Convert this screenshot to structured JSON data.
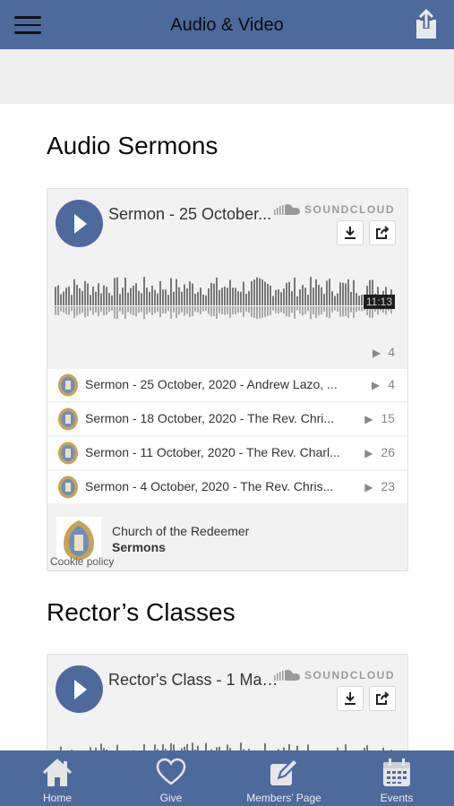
{
  "header": {
    "title": "Audio & Video",
    "menu_icon": "hamburger-icon",
    "share_icon": "share-icon"
  },
  "sections": [
    {
      "heading": "Audio Sermons"
    },
    {
      "heading": "Rector’s Classes"
    }
  ],
  "player1": {
    "track_title": "Sermon - 25 October...",
    "soundcloud_label": "SOUNDCLOUD",
    "duration": "11:13",
    "play_count": "4",
    "tracks": [
      {
        "title": "Sermon - 25 October, 2020 - Andrew Lazo, ...",
        "plays": "4"
      },
      {
        "title": "Sermon - 18 October, 2020 - The Rev. Chri...",
        "plays": "15"
      },
      {
        "title": "Sermon - 11 October, 2020 - The Rev. Charl...",
        "plays": "26"
      },
      {
        "title": "Sermon - 4 October, 2020 - The Rev. Chris...",
        "plays": "23"
      }
    ],
    "org_name": "Church of the Redeemer",
    "playlist_name": "Sermons",
    "cookie_label": "Cookie policy"
  },
  "player2": {
    "track_title": "Rector's Class - 1 Mar...",
    "soundcloud_label": "SOUNDCLOUD"
  },
  "tabs": [
    {
      "label": "Home",
      "icon": "home-icon"
    },
    {
      "label": "Give",
      "icon": "heart-icon"
    },
    {
      "label": "Members’ Page",
      "icon": "edit-icon"
    },
    {
      "label": "Events",
      "icon": "calendar-icon"
    }
  ],
  "colors": {
    "bar": "#4d6a9c",
    "band": "#efefef",
    "card": "#f2f2f2"
  }
}
